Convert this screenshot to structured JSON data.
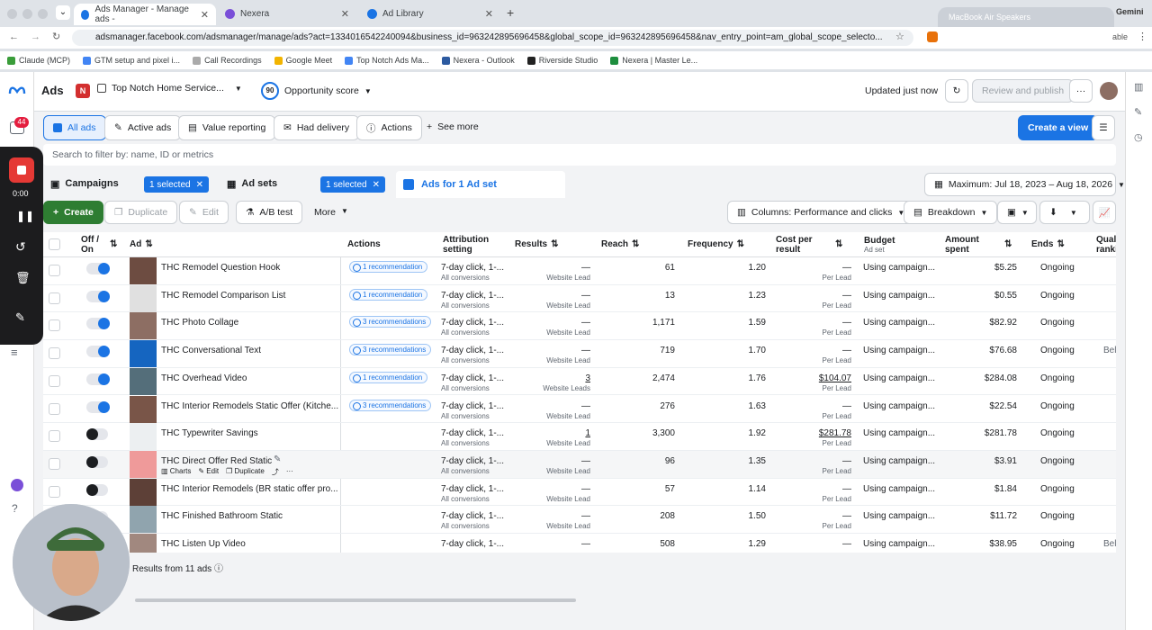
{
  "browser": {
    "tabs": [
      {
        "label": "Ads Manager - Manage ads -",
        "active": true
      },
      {
        "label": "Nexera",
        "active": false
      },
      {
        "label": "Ad Library",
        "active": false
      }
    ],
    "url": "adsmanager.facebook.com/adsmanager/manage/ads?act=1334016542240094&business_id=963242895696458&global_scope_id=963242895696458&nav_entry_point=am_global_scope_selecto...",
    "bookmarks": [
      "Claude (MCP)",
      "GTM setup and pixel i...",
      "Call Recordings",
      "Google Meet",
      "Top Notch Ads Ma...",
      "Nexera - Outlook",
      "Riverside Studio",
      "Nexera | Master Le..."
    ],
    "popup_title": "MacBook Air Speakers",
    "corner_text": "Gemini",
    "corner_text2": "able"
  },
  "header": {
    "section": "Ads",
    "account_badge": "N",
    "account_name": "Top Notch Home Service...",
    "score_value": "90",
    "score_label": "Opportunity score",
    "updated": "Updated just now",
    "review_publish": "Review and publish",
    "notif_count": "44"
  },
  "filters": {
    "tabs": [
      "All ads",
      "Active ads",
      "Value reporting",
      "Had delivery",
      "Actions"
    ],
    "see_more": "See more",
    "create_view": "Create a view"
  },
  "search": {
    "placeholder": "Search to filter by: name, ID or metrics"
  },
  "levels": {
    "campaigns": "Campaigns",
    "campaigns_chip": "1 selected",
    "adsets": "Ad sets",
    "adsets_chip": "1 selected",
    "ads": "Ads for 1 Ad set",
    "date_range": "Maximum: Jul 18, 2023 – Aug 18, 2026"
  },
  "toolbar": {
    "create": "Create",
    "duplicate": "Duplicate",
    "edit": "Edit",
    "ab_test": "A/B test",
    "more": "More",
    "columns": "Columns: Performance and clicks",
    "breakdown": "Breakdown"
  },
  "recorder": {
    "time": "0:00"
  },
  "table": {
    "headers": {
      "onoff": "Off / On",
      "ad": "Ad",
      "actions": "Actions",
      "attribution": "Attribution setting",
      "results": "Results",
      "reach": "Reach",
      "frequency": "Frequency",
      "cost": "Cost per result",
      "budget": "Budget",
      "budget_sub": "Ad set",
      "spent": "Amount spent",
      "ends": "Ends",
      "quality": "Quali ranki"
    },
    "rows": [
      {
        "name": "THC Remodel Question Hook",
        "on": true,
        "rec": "1 recommendation",
        "attr": "7-day click, 1-...",
        "attr_sub": "All conversions",
        "result": "—",
        "result_sub": "Website Lead",
        "reach": "61",
        "freq": "1.20",
        "cost": "—",
        "cost_sub": "Per Lead",
        "budget": "Using campaign...",
        "spent": "$5.25",
        "ends": "Ongoing",
        "quality": ""
      },
      {
        "name": "THC Remodel Comparison List",
        "on": true,
        "rec": "1 recommendation",
        "attr": "7-day click, 1-...",
        "attr_sub": "All conversions",
        "result": "—",
        "result_sub": "Website Lead",
        "reach": "13",
        "freq": "1.23",
        "cost": "—",
        "cost_sub": "Per Lead",
        "budget": "Using campaign...",
        "spent": "$0.55",
        "ends": "Ongoing",
        "quality": ""
      },
      {
        "name": "THC Photo Collage",
        "on": true,
        "rec": "3 recommendations",
        "attr": "7-day click, 1-...",
        "attr_sub": "All conversions",
        "result": "—",
        "result_sub": "Website Lead",
        "reach": "1,171",
        "freq": "1.59",
        "cost": "—",
        "cost_sub": "Per Lead",
        "budget": "Using campaign...",
        "spent": "$82.92",
        "ends": "Ongoing",
        "quality": ""
      },
      {
        "name": "THC Conversational Text",
        "on": true,
        "rec": "3 recommendations",
        "attr": "7-day click, 1-...",
        "attr_sub": "All conversions",
        "result": "—",
        "result_sub": "Website Lead",
        "reach": "719",
        "freq": "1.70",
        "cost": "—",
        "cost_sub": "Per Lead",
        "budget": "Using campaign...",
        "spent": "$76.68",
        "ends": "Ongoing",
        "quality": "Belo"
      },
      {
        "name": "THC Overhead Video",
        "on": true,
        "rec": "1 recommendation",
        "attr": "7-day click, 1-...",
        "attr_sub": "All conversions",
        "result": "3",
        "result_sub": "Website Leads",
        "reach": "2,474",
        "freq": "1.76",
        "cost": "$104.07",
        "cost_sub": "Per Lead",
        "budget": "Using campaign...",
        "spent": "$284.08",
        "ends": "Ongoing",
        "quality": ""
      },
      {
        "name": "THC Interior Remodels Static Offer (Kitche...",
        "on": true,
        "rec": "3 recommendations",
        "attr": "7-day click, 1-...",
        "attr_sub": "All conversions",
        "result": "—",
        "result_sub": "Website Lead",
        "reach": "276",
        "freq": "1.63",
        "cost": "—",
        "cost_sub": "Per Lead",
        "budget": "Using campaign...",
        "spent": "$22.54",
        "ends": "Ongoing",
        "quality": ""
      },
      {
        "name": "THC Typewriter Savings",
        "on": false,
        "rec": "",
        "attr": "7-day click, 1-...",
        "attr_sub": "All conversions",
        "result": "1",
        "result_sub": "Website Lead",
        "reach": "3,300",
        "freq": "1.92",
        "cost": "$281.78",
        "cost_sub": "Per Lead",
        "budget": "Using campaign...",
        "spent": "$281.78",
        "ends": "Ongoing",
        "quality": ""
      },
      {
        "name": "THC Direct Offer Red Static",
        "on": false,
        "rec": "",
        "attr": "7-day click, 1-...",
        "attr_sub": "All conversions",
        "result": "—",
        "result_sub": "Website Lead",
        "reach": "96",
        "freq": "1.35",
        "cost": "—",
        "cost_sub": "Per Lead",
        "budget": "Using campaign...",
        "spent": "$3.91",
        "ends": "Ongoing",
        "quality": "",
        "hover": true
      },
      {
        "name": "THC Interior Remodels (BR static offer pro...",
        "on": false,
        "rec": "",
        "attr": "7-day click, 1-...",
        "attr_sub": "All conversions",
        "result": "—",
        "result_sub": "Website Lead",
        "reach": "57",
        "freq": "1.14",
        "cost": "—",
        "cost_sub": "Per Lead",
        "budget": "Using campaign...",
        "spent": "$1.84",
        "ends": "Ongoing",
        "quality": ""
      },
      {
        "name": "THC Finished Bathroom Static",
        "on": false,
        "rec": "",
        "attr": "7-day click, 1-...",
        "attr_sub": "All conversions",
        "result": "—",
        "result_sub": "Website Lead",
        "reach": "208",
        "freq": "1.50",
        "cost": "—",
        "cost_sub": "Per Lead",
        "budget": "Using campaign...",
        "spent": "$11.72",
        "ends": "Ongoing",
        "quality": ""
      },
      {
        "name": "THC Listen Up Video",
        "on": false,
        "rec": "",
        "attr": "7-day click, 1-...",
        "attr_sub": "",
        "result": "—",
        "result_sub": "",
        "reach": "508",
        "freq": "1.29",
        "cost": "—",
        "cost_sub": "",
        "budget": "Using campaign...",
        "spent": "$38.95",
        "ends": "Ongoing",
        "quality": "Belo"
      }
    ],
    "hover_actions": [
      "Charts",
      "Edit",
      "Duplicate"
    ],
    "footer": "Results from 11 ads"
  },
  "colors": {
    "accent": "#1b74e4",
    "create_green": "#2e7d32"
  }
}
